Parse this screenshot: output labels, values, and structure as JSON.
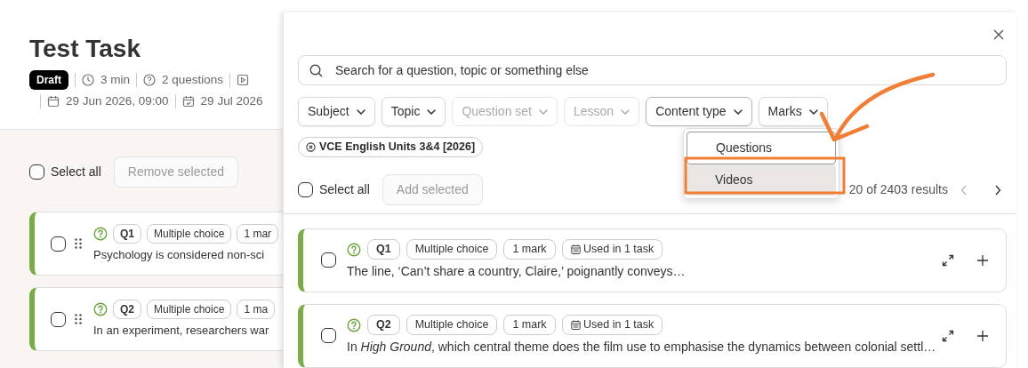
{
  "task_page": {
    "title": "Test Task",
    "status_badge": "Draft",
    "meta": [
      {
        "kind": "duration",
        "text": "3 min"
      },
      {
        "kind": "questions",
        "text": "2 questions"
      }
    ],
    "dates": [
      {
        "kind": "start",
        "text": "29 Jun 2026, 09:00"
      },
      {
        "kind": "due",
        "text": "29 Jul 2026"
      }
    ],
    "select_all": {
      "label": "Select all",
      "checked": false
    },
    "remove_button": {
      "label": "Remove selected",
      "disabled": true
    },
    "questions": [
      {
        "number": "Q1",
        "type": "Multiple choice",
        "marks": "1 mar",
        "text": "Psychology is considered non-sci",
        "checked": false
      },
      {
        "number": "Q2",
        "type": "Multiple choice",
        "marks": "1 ma",
        "text": "In an experiment, researchers war",
        "checked": false
      }
    ]
  },
  "drawer": {
    "search": {
      "placeholder": "Search for a question, topic or something else"
    },
    "filters": [
      {
        "label": "Subject",
        "disabled": false,
        "expanded": false
      },
      {
        "label": "Topic",
        "disabled": false,
        "expanded": false
      },
      {
        "label": "Question set",
        "disabled": true,
        "expanded": false
      },
      {
        "label": "Lesson",
        "disabled": true,
        "expanded": false
      },
      {
        "label": "Content type",
        "disabled": false,
        "expanded": true
      },
      {
        "label": "Marks",
        "disabled": false,
        "expanded": false
      }
    ],
    "active_filters": [
      "VCE English Units 3&4 [2026]"
    ],
    "dropdown_options": [
      {
        "label": "Questions",
        "selected": false
      },
      {
        "label": "Videos",
        "selected": true
      }
    ],
    "select_all": {
      "label": "Select all",
      "checked": false
    },
    "add_button": {
      "label": "Add selected",
      "disabled": true
    },
    "results": "20 of 2403 results",
    "pager": {
      "prev_disabled": true,
      "next_disabled": false
    },
    "questions": [
      {
        "number": "Q1",
        "type": "Multiple choice",
        "marks": "1 mark",
        "usage": "Used in 1 task",
        "text": "The line, ‘Can’t share a country, Claire,’ poignantly conveys…",
        "checked": false
      },
      {
        "number": "Q2",
        "type": "Multiple choice",
        "marks": "1 mark",
        "usage": "Used in 1 task",
        "text": "In *High Ground*, which central theme does the film use to emphasise the dynamics between colonial settl…",
        "checked": false
      }
    ]
  }
}
